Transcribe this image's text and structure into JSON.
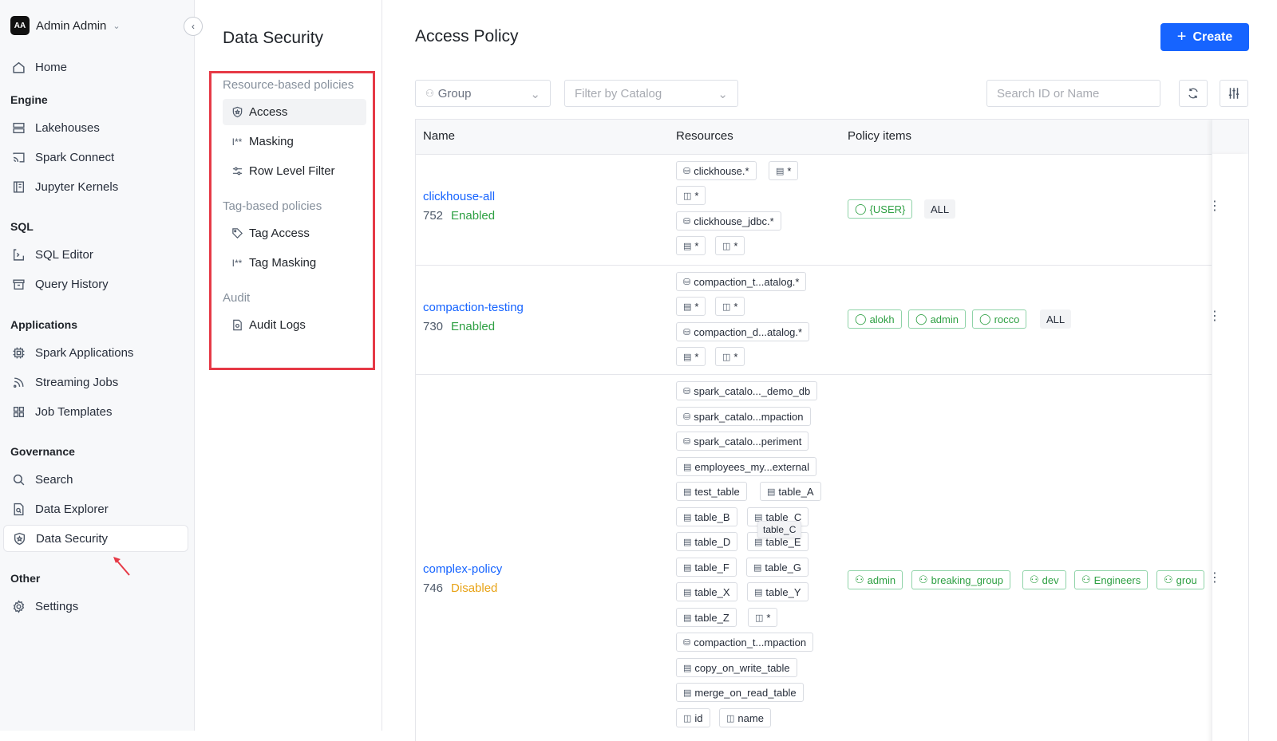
{
  "user": {
    "initials": "AA",
    "name": "Admin Admin"
  },
  "sidebar": {
    "home": "Home",
    "sections": {
      "engine": "Engine",
      "sql": "SQL",
      "applications": "Applications",
      "governance": "Governance",
      "other": "Other"
    },
    "items": {
      "lakehouses": "Lakehouses",
      "spark_connect": "Spark Connect",
      "jupyter_kernels": "Jupyter Kernels",
      "sql_editor": "SQL Editor",
      "query_history": "Query History",
      "spark_applications": "Spark Applications",
      "streaming_jobs": "Streaming Jobs",
      "job_templates": "Job Templates",
      "search": "Search",
      "data_explorer": "Data Explorer",
      "data_security": "Data Security",
      "settings": "Settings"
    },
    "active": "Data Security"
  },
  "subpanel": {
    "title": "Data Security",
    "groups": {
      "resource": "Resource-based policies",
      "tag": "Tag-based policies",
      "audit": "Audit"
    },
    "items": {
      "access": "Access",
      "masking": "Masking",
      "row_level_filter": "Row Level Filter",
      "tag_access": "Tag Access",
      "tag_masking": "Tag Masking",
      "audit_logs": "Audit Logs"
    },
    "active": "Access"
  },
  "main": {
    "title": "Access Policy",
    "create_label": "Create",
    "filters": {
      "group_placeholder": "Group",
      "catalog_placeholder": "Filter by Catalog",
      "search_placeholder": "Search ID or Name"
    },
    "table": {
      "headers": {
        "name": "Name",
        "resources": "Resources",
        "policy_items": "Policy items"
      },
      "rows": [
        {
          "name": "clickhouse-all",
          "id": "752",
          "status": "Enabled",
          "resources": [
            "clickhouse.*",
            "*",
            "*",
            "clickhouse_jdbc.*",
            "*",
            "*"
          ],
          "policy_items": [
            "{USER}"
          ],
          "all_label": "ALL"
        },
        {
          "name": "compaction-testing",
          "id": "730",
          "status": "Enabled",
          "resources": [
            "compaction_t...atalog.*",
            "*",
            "*",
            "compaction_d...atalog.*",
            "*",
            "*"
          ],
          "policy_items": [
            "alokh",
            "admin",
            "rocco"
          ],
          "all_label": "ALL"
        },
        {
          "name": "complex-policy",
          "id": "746",
          "status": "Disabled",
          "resources": [
            "spark_catalo..._demo_db",
            "spark_catalo...mpaction",
            "spark_catalo...periment",
            "employees_my...external",
            "test_table",
            "table_A",
            "table_B",
            "table_C",
            "table_D",
            "table_E",
            "table_F",
            "table_G",
            "table_X",
            "table_Y",
            "table_Z",
            "*",
            "compaction_t...mpaction",
            "copy_on_write_table",
            "merge_on_read_table",
            "id",
            "name"
          ],
          "policy_items": [
            "admin",
            "breaking_group",
            "dev",
            "Engineers",
            "grou"
          ]
        }
      ],
      "tooltip": "table_C"
    }
  },
  "colors": {
    "primary": "#1664ff",
    "enabled": "#2ea043",
    "disabled": "#e8a317",
    "highlight": "#e63946"
  }
}
